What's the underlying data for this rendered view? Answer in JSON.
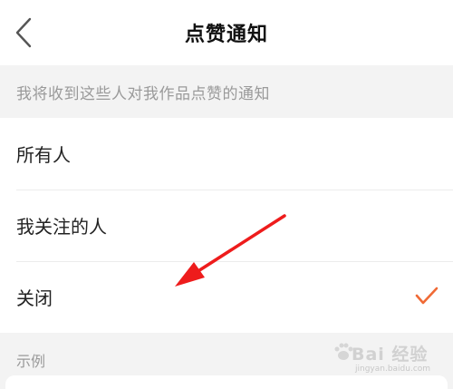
{
  "header": {
    "title": "点赞通知"
  },
  "section": {
    "description": "我将收到这些人对我作品点赞的通知"
  },
  "options": [
    {
      "label": "所有人",
      "selected": false
    },
    {
      "label": "我关注的人",
      "selected": false
    },
    {
      "label": "关闭",
      "selected": true
    }
  ],
  "example": {
    "label": "示例"
  },
  "watermark": {
    "brand": "Bai 经验",
    "site": "jingyan.baidu.com"
  },
  "colors": {
    "accent": "#f06a35",
    "annotation_arrow": "#ee1c1c"
  },
  "icons": {
    "back": "chevron-left-icon",
    "check": "checkmark-icon"
  }
}
